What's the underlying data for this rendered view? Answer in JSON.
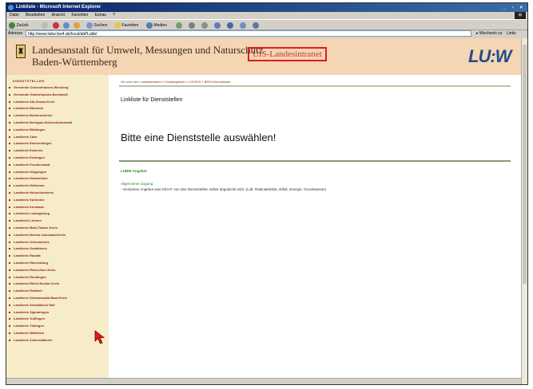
{
  "window": {
    "title": "Linkliste - Microsoft Internet Explorer",
    "controls": "_ ▫ ×"
  },
  "menubar": {
    "items": [
      "Datei",
      "Bearbeiten",
      "Ansicht",
      "Favoriten",
      "Extras",
      "?"
    ]
  },
  "toolbar": {
    "back_label": "Zurück",
    "search_label": "Suchen",
    "favorites_label": "Favoriten",
    "media_label": "Medien"
  },
  "addressbar": {
    "label": "Adresse",
    "url": "http://www.lubw-bw4.de/local/abf/Lubb/",
    "go_label": "Wechseln zu",
    "links_label": "Links"
  },
  "header": {
    "org_line1": "Landesanstalt für Umwelt, Messungen und Naturschutz",
    "org_line2": "Baden-Württemberg",
    "intranet_label": "UIS-Landesintranet",
    "logo_text": "LU:W",
    "crest_glyph": "♜"
  },
  "sidebar": {
    "heading": "DIENSTSTELLEN",
    "items": [
      "Gemeinde Ochsenhausen-Weinberg",
      "Gemeinde Grafenhausen-Bernhardt",
      "Landkreis Alb-Donau-Kreis",
      "Landkreis Biberach",
      "Landkreis Bodenseekreis",
      "Landkreis Breisgau-Hochschwarzwald",
      "Landkreis Böblingen",
      "Landkreis Calw",
      "Landkreis Emmendingen",
      "Landkreis Enzkreis",
      "Landkreis Esslingen",
      "Landkreis Freudenstadt",
      "Landkreis Göppingen",
      "Landkreis Heidenheim",
      "Landkreis Heilbronn",
      "Landkreis Hohenlohekreis",
      "Landkreis Karlsruhe",
      "Landkreis Konstanz",
      "Landkreis Ludwigsburg",
      "Landkreis Lörrach",
      "Landkreis Main-Tauber-Kreis",
      "Landkreis Neckar-Odenwald-Kreis",
      "Landkreis Ortenaukreis",
      "Landkreis Ostalbkreis",
      "Landkreis Rastatt",
      "Landkreis Ravensburg",
      "Landkreis Rems-Murr-Kreis",
      "Landkreis Reutlingen",
      "Landkreis Rhein-Neckar-Kreis",
      "Landkreis Rottweil",
      "Landkreis Schwarzwald-Baar-Kreis",
      "Landkreis Schwäbisch Hall",
      "Landkreis Sigmaringen",
      "Landkreis Tuttlingen",
      "Landkreis Tübingen",
      "Landkreis Waldshut",
      "Landkreis Zollernalbkreis"
    ]
  },
  "content": {
    "breadcrumb_lead": "Sie sind hier:",
    "breadcrumb_path": "Landesintranet » Fachangebote » LIS BVS » BRS-Erkenntnisse",
    "page_title": "Linkliste für Dienststellen",
    "prompt": "Bitte eine Dienststelle auswählen!",
    "angebot_heading": "LUBW Angebot",
    "angebot_link": "Allgemeiner Zugang",
    "angebot_note": "- Gesamtes Angebot was NICHT von den Dienststellen selbst abgedeckt wird. (Luft, Radioaktivität, Abfall, Energie, Grundwasser)"
  },
  "colors": {
    "header_bg": "#f4d5b4",
    "sidebar_bg": "#f6ecc7",
    "link_red": "#8a1c1c",
    "accent_green": "#2e8b2e",
    "intranet_border": "#e21b1b",
    "logo_blue": "#234d8c"
  }
}
